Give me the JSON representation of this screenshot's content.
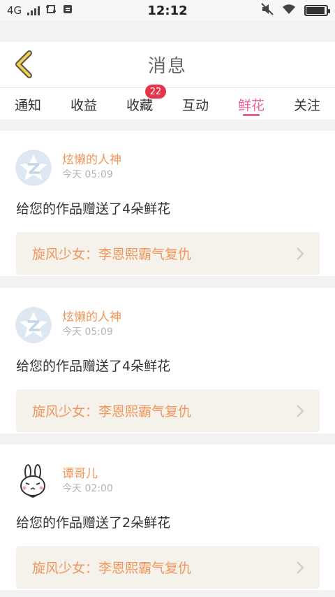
{
  "status_bar": {
    "network": "4G",
    "time": "12:12"
  },
  "header": {
    "title": "消息"
  },
  "tabs": [
    {
      "label": "通知"
    },
    {
      "label": "收益"
    },
    {
      "label": "收藏",
      "badge": "22"
    },
    {
      "label": "互动"
    },
    {
      "label": "鲜花",
      "active": true
    },
    {
      "label": "关注"
    }
  ],
  "messages": [
    {
      "user": "炫懒的人神",
      "time": "今天 05:09",
      "text": "给您的作品赠送了4朵鲜花",
      "work_title": "旋风少女：李恩熙霸气复仇",
      "avatar_icon": "default-avatar-icon"
    },
    {
      "user": "炫懒的人神",
      "time": "今天 05:09",
      "text": "给您的作品赠送了4朵鲜花",
      "work_title": "旋风少女：李恩熙霸气复仇",
      "avatar_icon": "default-avatar-icon"
    },
    {
      "user": "谭哥儿",
      "time": "今天 02:00",
      "text": "给您的作品赠送了2朵鲜花",
      "work_title": "旋风少女：李恩熙霸气复仇",
      "avatar_icon": "rabbit-avatar-icon"
    }
  ],
  "colors": {
    "accent": "#e8639a",
    "username": "#f0965a",
    "badge": "#e8334a",
    "back_arrow": "#f2d04a"
  }
}
